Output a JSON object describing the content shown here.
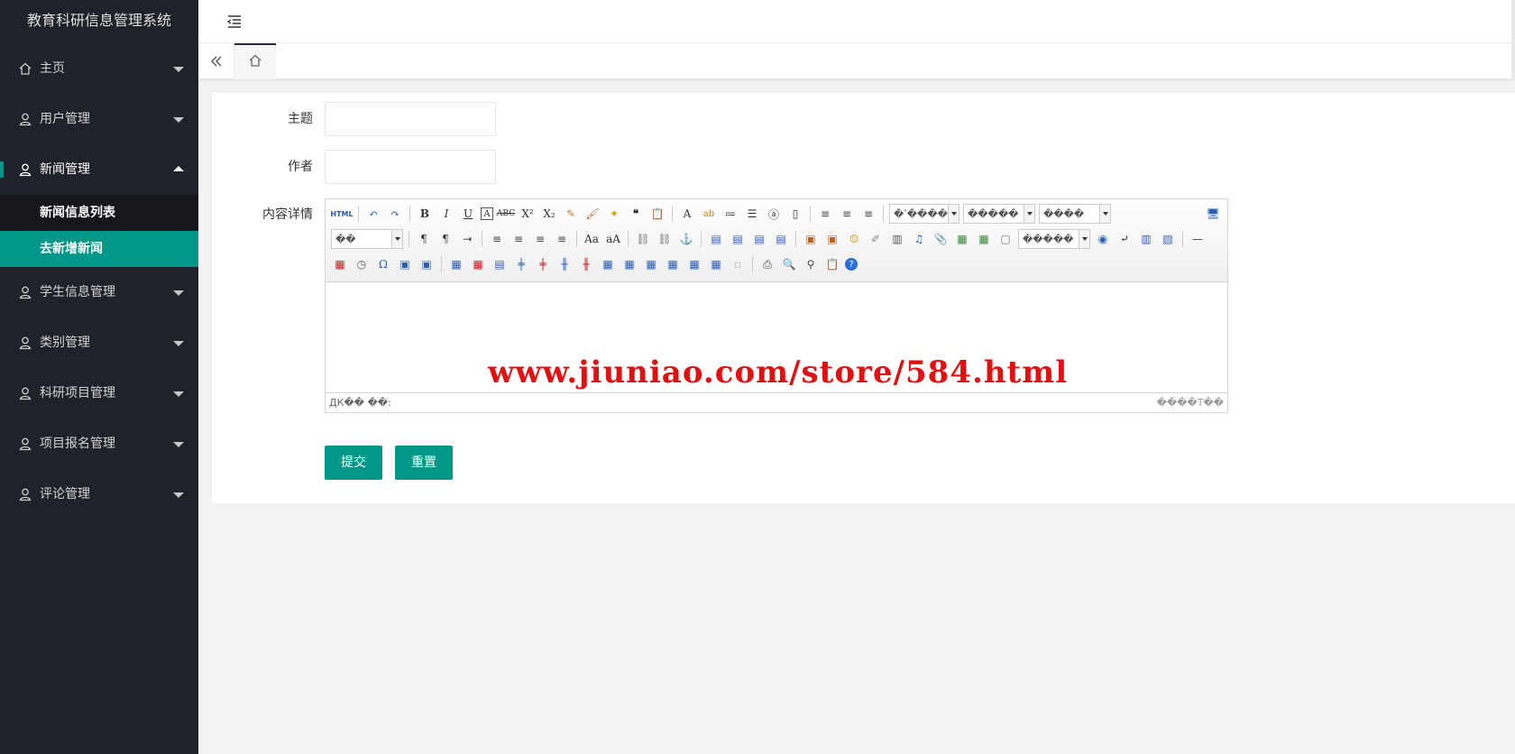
{
  "app": {
    "title": "教育科研信息管理系统"
  },
  "sidebar": {
    "items": [
      {
        "label": "主页",
        "icon": "home-icon",
        "open": false
      },
      {
        "label": "用户管理",
        "icon": "user-icon",
        "open": false
      },
      {
        "label": "新闻管理",
        "icon": "user-icon",
        "open": true,
        "children": [
          {
            "label": "新闻信息列表",
            "active": false
          },
          {
            "label": "去新增新闻",
            "active": true
          }
        ]
      },
      {
        "label": "学生信息管理",
        "icon": "user-icon",
        "open": false
      },
      {
        "label": "类别管理",
        "icon": "user-icon",
        "open": false
      },
      {
        "label": "科研项目管理",
        "icon": "user-icon",
        "open": false
      },
      {
        "label": "项目报名管理",
        "icon": "user-icon",
        "open": false
      },
      {
        "label": "评论管理",
        "icon": "user-icon",
        "open": false
      }
    ]
  },
  "form": {
    "subject_label": "主题",
    "subject_value": "",
    "author_label": "作者",
    "author_value": "",
    "content_label": "内容详情"
  },
  "editor": {
    "toolbar_html_label": "HTML",
    "combo_font_family": "�ʽ����",
    "combo_font_size": "�����",
    "combo_paragraph": "����",
    "combo_style": "��",
    "combo_custom": "�����",
    "status_left": "ДК�� ��:",
    "status_right": "����Т��",
    "watermark": "www.jiuniao.com/store/584.html"
  },
  "buttons": {
    "submit": "提交",
    "reset": "重置"
  },
  "colors": {
    "sidebar_bg": "#20222a",
    "accent": "#009688",
    "watermark": "#e21111"
  }
}
